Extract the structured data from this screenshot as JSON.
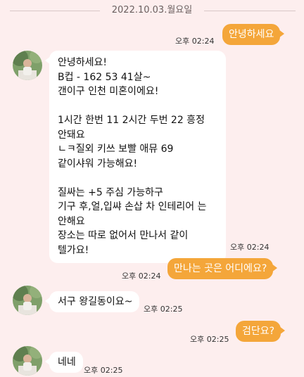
{
  "date_divider": "2022.10.03.월요일",
  "messages": [
    {
      "direction": "out",
      "text": "안녕하세요",
      "time": "오후 02:24"
    },
    {
      "direction": "in",
      "text": "안녕하세요!\nB컵 - 162 53 41살~\n갠이구 인천 미혼이에요!\n\n1시간 한번 11 2시간 두번 22 흥정\n안돼요\nㄴㅋ질외 키쓰 보빨 애뮤 69\n같이샤워 가능해요!\n\n질싸는 +5 주심 가능하구\n기구 후,얼,입쌰 손삽 차 인테리어 는\n안해요\n장소는 따로 없어서 만나서 같이\n텔가요!",
      "time": "오후 02:24"
    },
    {
      "direction": "out",
      "text": "만나는 곳은 어디에요?",
      "time": "오후 02:24"
    },
    {
      "direction": "in",
      "text": "서구 왕길동이요~",
      "time": "오후 02:25"
    },
    {
      "direction": "out",
      "text": "검단요?",
      "time": "오후 02:25"
    },
    {
      "direction": "in",
      "text": "네네",
      "time": "오후 02:25"
    }
  ]
}
